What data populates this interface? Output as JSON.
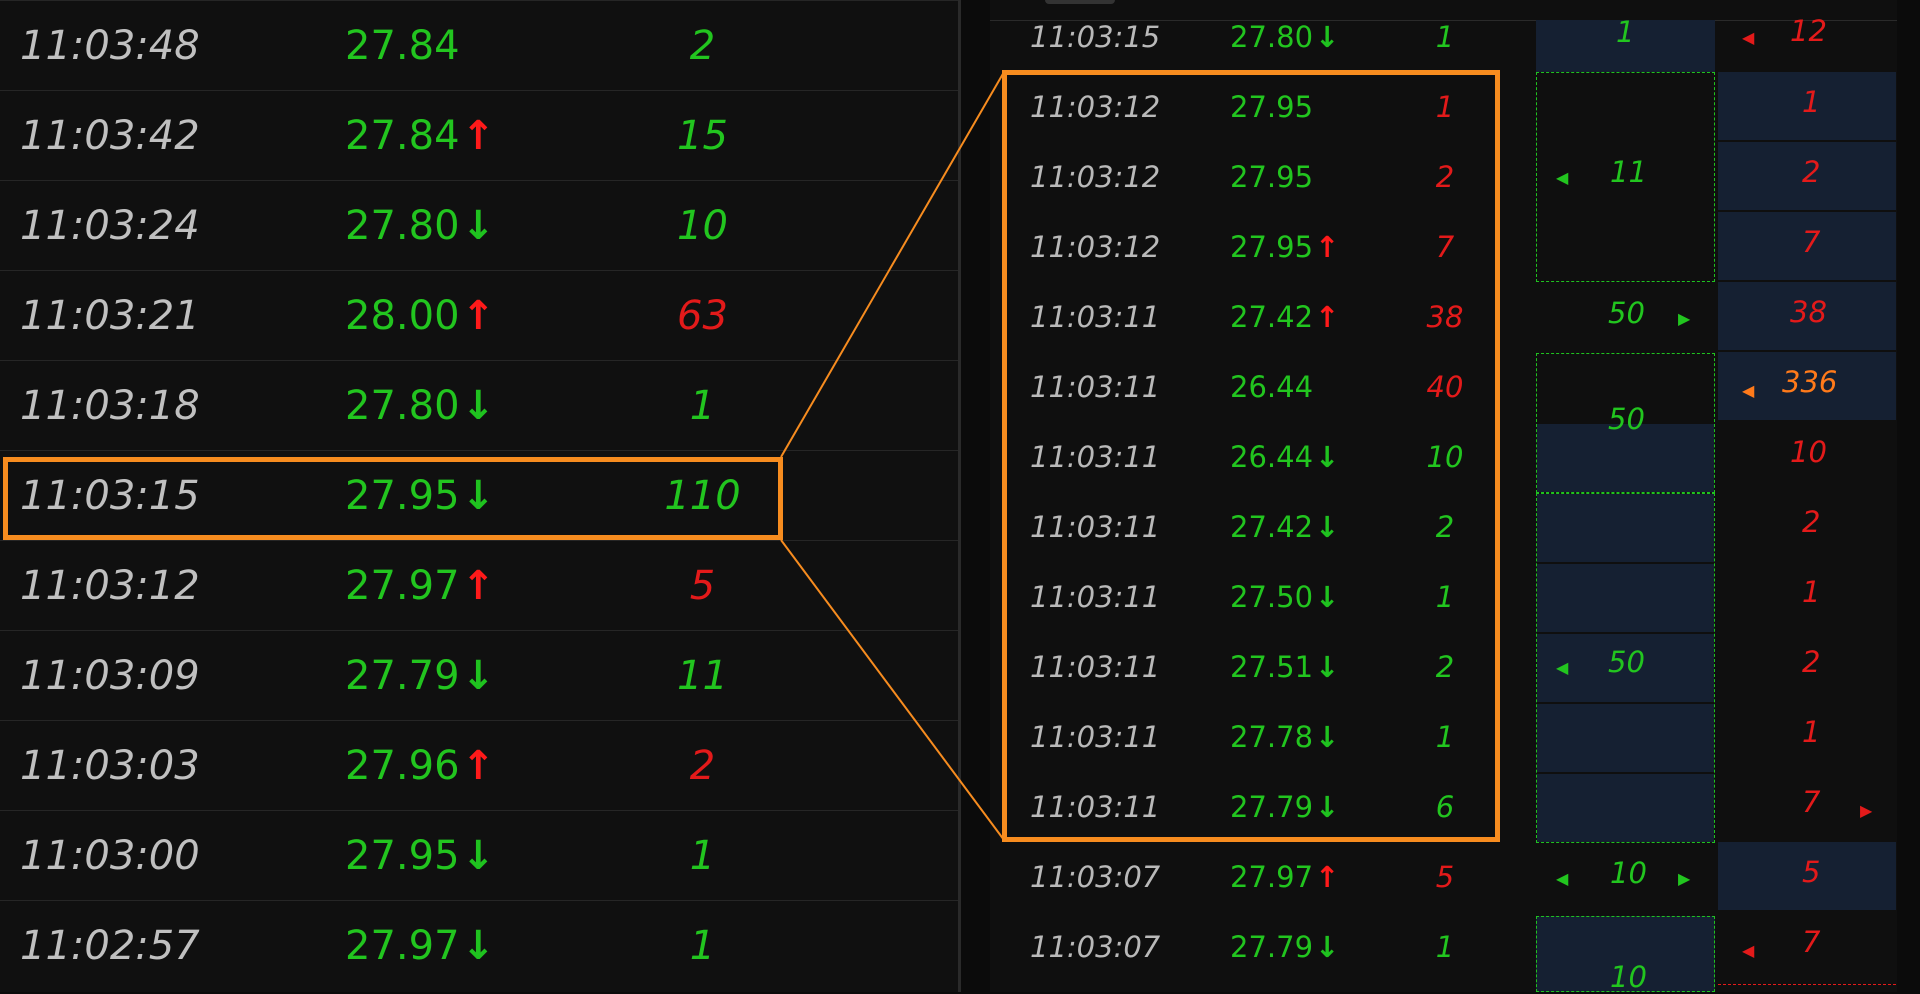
{
  "left_rows": [
    {
      "time": "11:03:48",
      "price": "27.84",
      "arrow": "",
      "vol": "2",
      "vol_color": "green"
    },
    {
      "time": "11:03:42",
      "price": "27.84",
      "arrow": "↑",
      "vol": "15",
      "vol_color": "green"
    },
    {
      "time": "11:03:24",
      "price": "27.80",
      "arrow": "↓",
      "vol": "10",
      "vol_color": "green"
    },
    {
      "time": "11:03:21",
      "price": "28.00",
      "arrow": "↑",
      "vol": "63",
      "vol_color": "red"
    },
    {
      "time": "11:03:18",
      "price": "27.80",
      "arrow": "↓",
      "vol": "1",
      "vol_color": "green"
    },
    {
      "time": "11:03:15",
      "price": "27.95",
      "arrow": "↓",
      "vol": "110",
      "vol_color": "green"
    },
    {
      "time": "11:03:12",
      "price": "27.97",
      "arrow": "↑",
      "vol": "5",
      "vol_color": "red"
    },
    {
      "time": "11:03:09",
      "price": "27.79",
      "arrow": "↓",
      "vol": "11",
      "vol_color": "green"
    },
    {
      "time": "11:03:03",
      "price": "27.96",
      "arrow": "↑",
      "vol": "2",
      "vol_color": "red"
    },
    {
      "time": "11:03:00",
      "price": "27.95",
      "arrow": "↓",
      "vol": "1",
      "vol_color": "green"
    },
    {
      "time": "11:02:57",
      "price": "27.97",
      "arrow": "↓",
      "vol": "1",
      "vol_color": "green"
    }
  ],
  "right_rows": [
    {
      "time": "11:03:15",
      "price": "27.80",
      "arrow": "↓",
      "vol": "1",
      "vol_color": "green"
    },
    {
      "time": "11:03:12",
      "price": "27.95",
      "arrow": "",
      "vol": "1",
      "vol_color": "red"
    },
    {
      "time": "11:03:12",
      "price": "27.95",
      "arrow": "",
      "vol": "2",
      "vol_color": "red"
    },
    {
      "time": "11:03:12",
      "price": "27.95",
      "arrow": "↑",
      "vol": "7",
      "vol_color": "red"
    },
    {
      "time": "11:03:11",
      "price": "27.42",
      "arrow": "↑",
      "vol": "38",
      "vol_color": "red"
    },
    {
      "time": "11:03:11",
      "price": "26.44",
      "arrow": "",
      "vol": "40",
      "vol_color": "red"
    },
    {
      "time": "11:03:11",
      "price": "26.44",
      "arrow": "↓",
      "vol": "10",
      "vol_color": "green"
    },
    {
      "time": "11:03:11",
      "price": "27.42",
      "arrow": "↓",
      "vol": "2",
      "vol_color": "green"
    },
    {
      "time": "11:03:11",
      "price": "27.50",
      "arrow": "↓",
      "vol": "1",
      "vol_color": "green"
    },
    {
      "time": "11:03:11",
      "price": "27.51",
      "arrow": "↓",
      "vol": "2",
      "vol_color": "green"
    },
    {
      "time": "11:03:11",
      "price": "27.78",
      "arrow": "↓",
      "vol": "1",
      "vol_color": "green"
    },
    {
      "time": "11:03:11",
      "price": "27.79",
      "arrow": "↓",
      "vol": "6",
      "vol_color": "green"
    },
    {
      "time": "11:03:07",
      "price": "27.97",
      "arrow": "↑",
      "vol": "5",
      "vol_color": "red"
    },
    {
      "time": "11:03:07",
      "price": "27.79",
      "arrow": "↓",
      "vol": "1",
      "vol_color": "green"
    }
  ],
  "match_col": {
    "top_1": "1",
    "box_11": "11",
    "row_50": "50",
    "box_50a": "50",
    "row_50b": "50",
    "row_10": "10",
    "bottom_10": "10"
  },
  "right_col": {
    "top_12": "12",
    "vals": [
      "1",
      "2",
      "7",
      "38",
      "336",
      "10",
      "2",
      "1",
      "2",
      "1",
      "7",
      "5",
      "7"
    ]
  },
  "colors": {
    "accent": "#f78c1f",
    "up": "#ff1a1a",
    "down": "#1fc21f",
    "cell_bg": "#152032"
  }
}
